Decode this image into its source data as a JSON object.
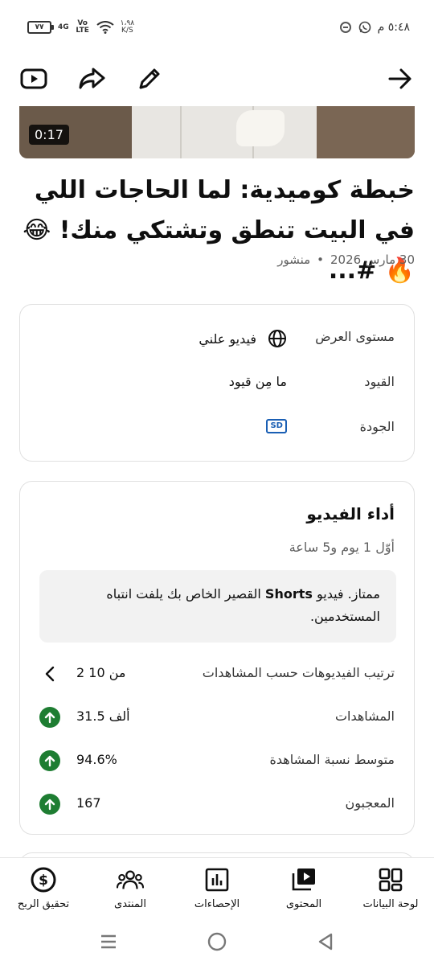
{
  "status_bar": {
    "battery": "٧٧",
    "network_gen": "4G",
    "volte": "Vo LTE",
    "speed_value": "١،٩٨",
    "speed_unit": "K/S",
    "time": "٥:٤٨ م"
  },
  "toolbar": {
    "icons": [
      "youtube-icon",
      "share-icon",
      "edit-icon",
      "arrow-forward-icon"
    ]
  },
  "video": {
    "duration": "0:17",
    "title": "خبطة كوميدية: لما الحاجات اللي في البيت تنطق وتشتكي منك! 😂🔥 #...",
    "date": "30 مارس 2026",
    "separator": "•",
    "status": "منشور"
  },
  "details": {
    "visibility_label": "مستوى العرض",
    "visibility_value": "فيديو علني",
    "restrictions_label": "القيود",
    "restrictions_value": "ما مِن قيود",
    "quality_label": "الجودة",
    "quality_badge": "SD"
  },
  "performance": {
    "title": "أداء الفيديو",
    "subtitle": "أوّل 1 يوم و5 ساعة",
    "note_part1": "ممتاز. فيديو ",
    "note_bold": "Shorts",
    "note_part2": " القصير الخاص بك يلفت انتباه المستخدمين.",
    "rows": [
      {
        "label": "ترتيب الفيديوهات حسب المشاهدات",
        "value": "2 من 10",
        "indicator": "chevron"
      },
      {
        "label": "المشاهدات",
        "value": "31.5 ألف",
        "indicator": "up"
      },
      {
        "label": "متوسط نسبة المشاهدة",
        "value": "94.6%",
        "indicator": "up"
      },
      {
        "label": "المعجبون",
        "value": "167",
        "indicator": "up"
      }
    ]
  },
  "bottom_nav": [
    {
      "label": "لوحة البيانات",
      "icon": "dashboard-icon"
    },
    {
      "label": "المحتوى",
      "icon": "content-icon"
    },
    {
      "label": "الإحصاءات",
      "icon": "analytics-icon"
    },
    {
      "label": "المنتدى",
      "icon": "community-icon"
    },
    {
      "label": "تحقيق الربح",
      "icon": "earn-icon"
    }
  ],
  "colors": {
    "accent_green": "#1e7d32",
    "sd_blue": "#1a5fb4"
  }
}
